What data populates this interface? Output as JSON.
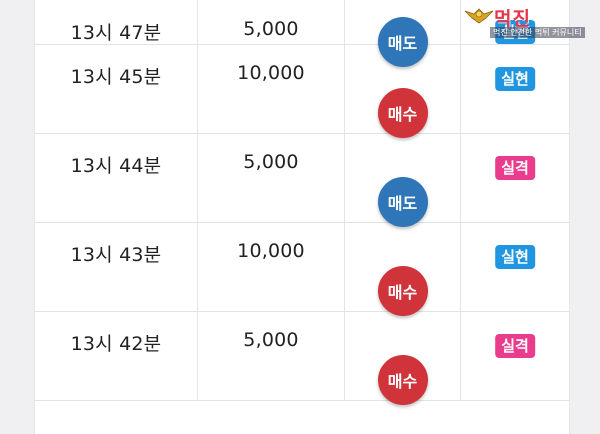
{
  "rows": [
    {
      "time": "13시 47분",
      "amount": "5,000",
      "side": "매도",
      "side_type": "sell",
      "result": "실현",
      "result_type": "win"
    },
    {
      "time": "13시 45분",
      "amount": "10,000",
      "side": "매수",
      "side_type": "buy",
      "result": "실현",
      "result_type": "win"
    },
    {
      "time": "13시 44분",
      "amount": "5,000",
      "side": "매도",
      "side_type": "sell",
      "result": "실격",
      "result_type": "lose"
    },
    {
      "time": "13시 43분",
      "amount": "10,000",
      "side": "매수",
      "side_type": "buy",
      "result": "실현",
      "result_type": "win"
    },
    {
      "time": "13시 42분",
      "amount": "5,000",
      "side": "매수",
      "side_type": "buy",
      "result": "실격",
      "result_type": "lose"
    }
  ],
  "colors": {
    "sell": "#2f76b8",
    "buy": "#d0343a",
    "win": "#2196e0",
    "lose": "#ea3c8c"
  },
  "watermark": {
    "brand": "먹진",
    "tagline": "먹진 안전한 먹튀 커뮤니티",
    "icon": "eagle-emblem-icon"
  }
}
